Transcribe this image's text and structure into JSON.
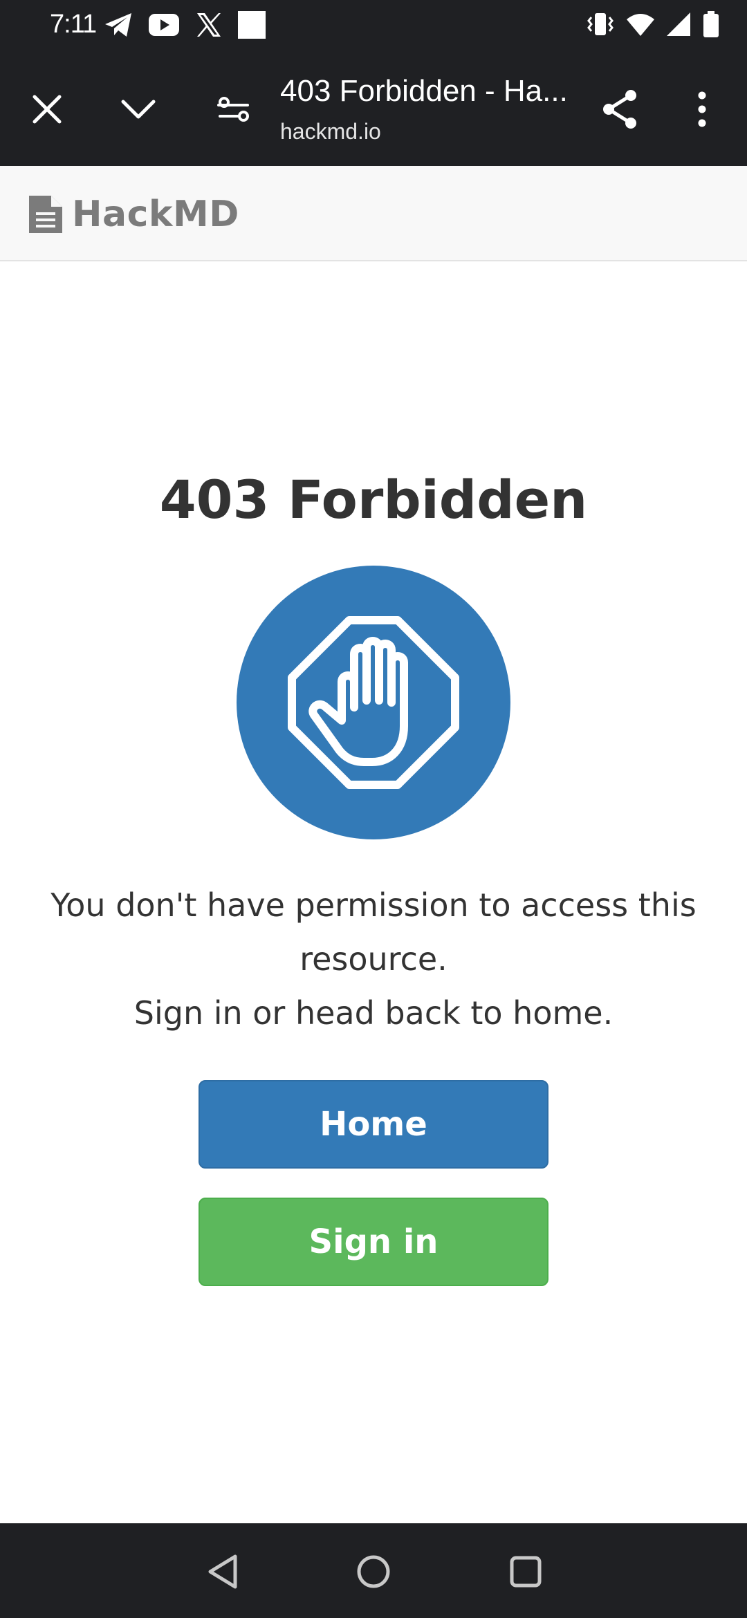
{
  "status_bar": {
    "time": "7:11",
    "left_icons": [
      "telegram-icon",
      "youtube-icon",
      "x-icon",
      "blank-square-icon"
    ],
    "right_icons": [
      "vibrate-icon",
      "wifi-icon",
      "signal-icon",
      "battery-icon"
    ]
  },
  "browser": {
    "page_title": "403 Forbidden - Ha...",
    "url": "hackmd.io",
    "buttons": [
      "close-icon",
      "chevron-down-icon",
      "page-settings-icon",
      "share-icon",
      "more-vert-icon"
    ]
  },
  "site_header": {
    "brand": "HackMD",
    "brand_icon": "file-text-icon"
  },
  "main": {
    "title": "403 Forbidden",
    "icon": "stop-hand-icon",
    "message_line1": "You don't have permission to access this resource.",
    "message_line2": "Sign in or head back to home.",
    "home_label": "Home",
    "signin_label": "Sign in"
  },
  "colors": {
    "primary": "#337ab7",
    "success": "#5cb85c",
    "system_bar": "#1f2023"
  },
  "nav_bar": {
    "buttons": [
      "back-icon",
      "home-icon",
      "recents-icon"
    ]
  }
}
